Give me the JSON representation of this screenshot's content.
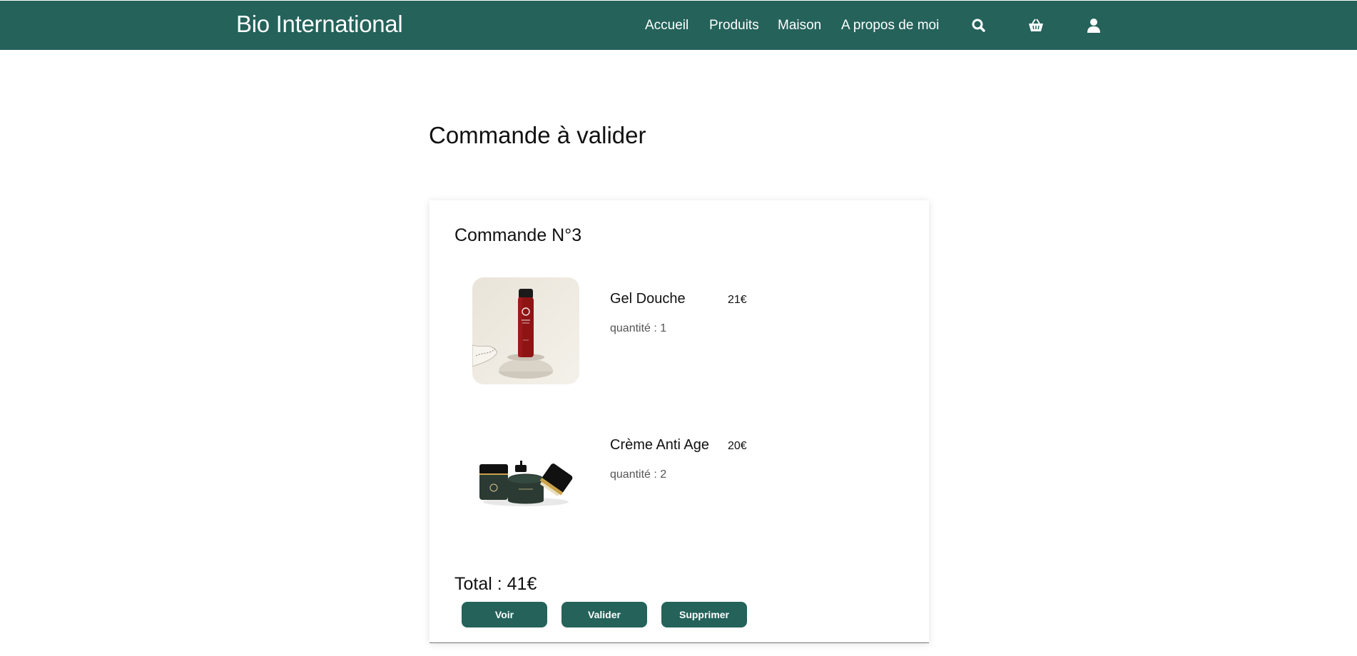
{
  "navbar": {
    "brand": "Bio International",
    "links": [
      {
        "label": "Accueil"
      },
      {
        "label": "Produits"
      },
      {
        "label": "Maison"
      },
      {
        "label": "A propos de moi"
      }
    ],
    "icons": [
      "search-icon",
      "basket-icon",
      "user-icon"
    ],
    "background_color": "#24625a"
  },
  "page": {
    "title": "Commande à valider"
  },
  "order": {
    "title": "Commande N°3",
    "items": [
      {
        "name": "Gel Douche",
        "price": "21€",
        "quantity": "quantité : 1",
        "image": "shower-gel-bottle"
      },
      {
        "name": "Crème Anti Age",
        "price": "20€",
        "quantity": "quantité : 2",
        "image": "anti-age-cream-jars"
      }
    ],
    "total": "Total : 41€",
    "buttons": {
      "view": "Voir",
      "validate": "Valider",
      "delete": "Supprimer"
    }
  }
}
